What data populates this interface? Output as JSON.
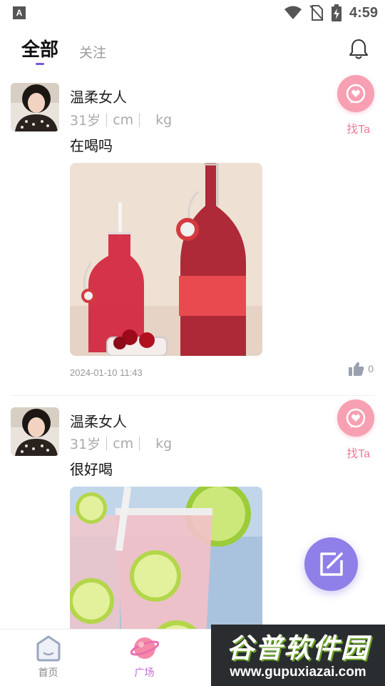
{
  "status_bar": {
    "left_icon": "A",
    "time": "4:59"
  },
  "header": {
    "tab_all": "全部",
    "tab_follow": "关注",
    "bell_icon": "bell-icon"
  },
  "posts": [
    {
      "username": "温柔女人",
      "age": "31岁",
      "height_unit": "cm",
      "weight_unit": "kg",
      "text": "在喝吗",
      "time": "2024-01-10 11:43",
      "likes": "0",
      "find_label": "找Ta"
    },
    {
      "username": "温柔女人",
      "age": "31岁",
      "height_unit": "cm",
      "weight_unit": "kg",
      "text": "很好喝",
      "find_label": "找Ta"
    }
  ],
  "nav": {
    "home": "首页",
    "square": "广场"
  },
  "watermark": {
    "main": "谷普软件园",
    "url": "www.gupuxiazai.com"
  },
  "colors": {
    "accent_purple": "#7a55e0",
    "find_pink": "#f07a98",
    "fab_purple": "#8f7fe8",
    "nav_active": "#c06cd8"
  }
}
